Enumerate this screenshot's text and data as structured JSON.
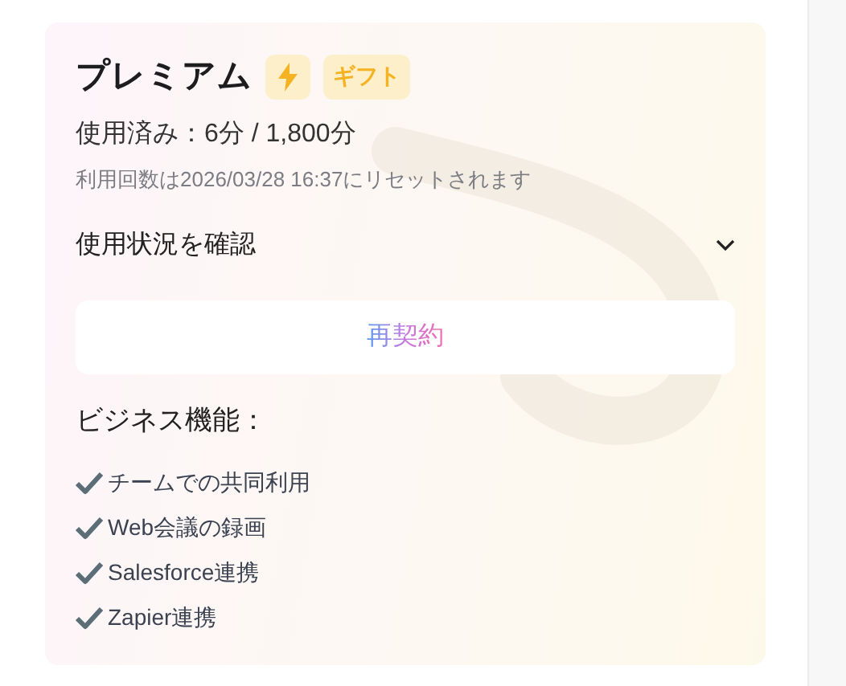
{
  "plan": {
    "title": "プレミアム",
    "badge": "ギフト",
    "usage": "使用済み：6分 / 1,800分",
    "reset_note": "利用回数は2026/03/28 16:37にリセットされます"
  },
  "usage_toggle": {
    "label": "使用状況を確認",
    "expanded": false
  },
  "renew_button": "再契約",
  "features": {
    "heading": "ビジネス機能：",
    "items": [
      "チームでの共同利用",
      "Web会議の録画",
      "Salesforce連携",
      "Zapier連携"
    ]
  }
}
